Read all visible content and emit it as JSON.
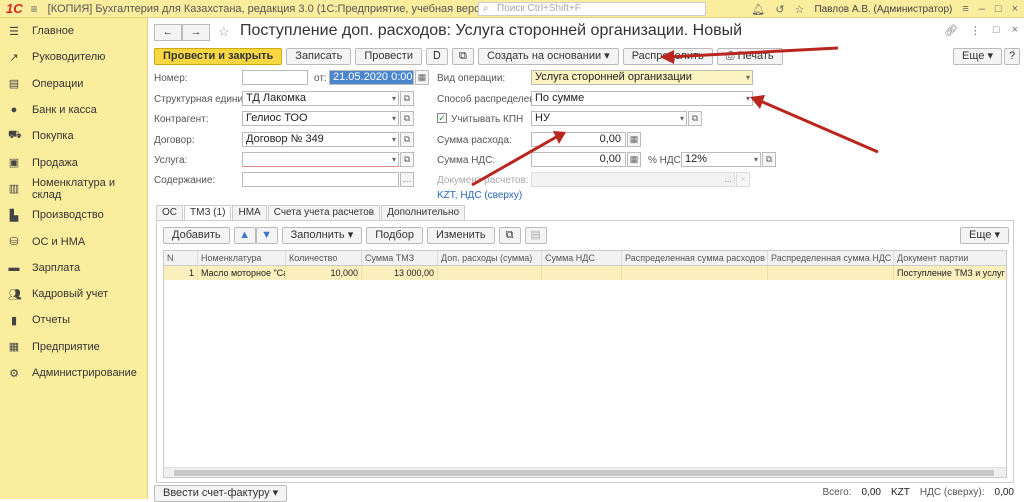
{
  "topbar": {
    "logo": "1С",
    "app_title": "[КОПИЯ] Бухгалтерия для Казахстана, редакция 3.0  (1С:Предприятие, учебная версия)",
    "search_placeholder": "Поиск Ctrl+Shift+F",
    "user": "Павлов А.В. (Администратор)"
  },
  "sidebar": {
    "items": [
      {
        "label": "Главное",
        "icon": "menu-icon"
      },
      {
        "label": "Руководителю",
        "icon": "chart-icon"
      },
      {
        "label": "Операции",
        "icon": "ops-icon"
      },
      {
        "label": "Банк и касса",
        "icon": "bank-icon"
      },
      {
        "label": "Покупка",
        "icon": "cart-icon"
      },
      {
        "label": "Продажа",
        "icon": "bag-icon"
      },
      {
        "label": "Номенклатура и склад",
        "icon": "warehouse-icon"
      },
      {
        "label": "Производство",
        "icon": "factory-icon"
      },
      {
        "label": "ОС и НМА",
        "icon": "assets-icon"
      },
      {
        "label": "Зарплата",
        "icon": "salary-icon"
      },
      {
        "label": "Кадровый учет",
        "icon": "people-icon"
      },
      {
        "label": "Отчеты",
        "icon": "reports-icon"
      },
      {
        "label": "Предприятие",
        "icon": "enterprise-icon"
      },
      {
        "label": "Администрирование",
        "icon": "gear-icon"
      }
    ]
  },
  "doc": {
    "title": "Поступление доп. расходов: Услуга сторонней организации. Новый"
  },
  "toolbar": {
    "post_close": "Провести и закрыть",
    "save": "Записать",
    "post": "Провести",
    "create_based": "Создать на основании",
    "distribute": "Распределить",
    "print": "Печать",
    "more": "Еще",
    "help": "?"
  },
  "form": {
    "number_label": "Номер:",
    "number_value": "",
    "date_from_label": "от:",
    "date_value": "21.05.2020  0:00:00",
    "op_type_label": "Вид операции:",
    "op_type_value": "Услуга сторонней организации",
    "struct_unit_label": "Структурная единица:",
    "struct_unit_value": "ТД Лакомка",
    "dist_method_label": "Способ распределения:",
    "dist_method_value": "По сумме",
    "contractor_label": "Контрагент:",
    "contractor_value": "Гелиос ТОО",
    "kpn_label": "Учитывать КПН",
    "kpn_value": "НУ",
    "contract_label": "Договор:",
    "contract_value": "Договор № 349",
    "expense_sum_label": "Сумма расхода:",
    "expense_sum_value": "0,00",
    "service_label": "Услуга:",
    "service_value": "",
    "vat_sum_label": "Сумма НДС:",
    "vat_sum_value": "0,00",
    "vat_rate_label": "% НДС:",
    "vat_rate_value": "12%",
    "content_label": "Содержание:",
    "content_value": "",
    "settlement_doc_label": "Документ расчетов:",
    "settlement_doc_value": "",
    "currency_link": "KZT, НДС (сверху)"
  },
  "tabs": [
    "ОС",
    "ТМЗ (1)",
    "НМА",
    "Счета учета расчетов",
    "Дополнительно"
  ],
  "table_toolbar": {
    "add": "Добавить",
    "fill": "Заполнить",
    "pick": "Подбор",
    "change": "Изменить",
    "more": "Еще"
  },
  "table": {
    "columns": [
      "N",
      "Номенклатура",
      "Количество",
      "Сумма ТМЗ",
      "Доп. расходы (сумма)",
      "Сумма НДС",
      "Распределенная сумма расходов",
      "Распределенная сумма НДС",
      "Документ партии"
    ],
    "rows": [
      [
        "1",
        "Масло моторное \"Cast...",
        "10,000",
        "13 000,00",
        "",
        "",
        "",
        "",
        "Поступление ТМЗ и услуг"
      ]
    ]
  },
  "footer": {
    "invoice_btn": "Ввести счет-фактуру",
    "total_label": "Всего:",
    "total_value": "0,00",
    "currency": "KZT",
    "vat_label": "НДС (сверху):",
    "vat_value": "0,00"
  }
}
